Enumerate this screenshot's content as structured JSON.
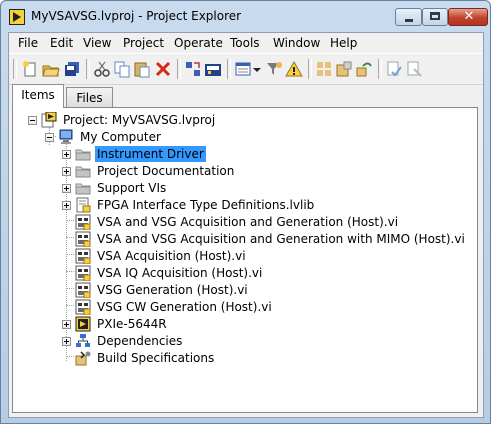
{
  "window": {
    "title": "MyVSAVSG.lvproj - Project Explorer"
  },
  "menu": [
    "File",
    "Edit",
    "View",
    "Project",
    "Operate",
    "Tools",
    "Window",
    "Help"
  ],
  "toolbar": {
    "icons": [
      "new-icon",
      "open-icon",
      "save-all-icon",
      "cut-icon",
      "copy-icon",
      "paste-icon",
      "delete-icon",
      "build-icon",
      "deploy-icon",
      "view-icon",
      "dropdown-arrow-icon",
      "filter-icon",
      "warning-icon",
      "group-icon",
      "tool1-icon",
      "tool2-icon",
      "tool3-icon",
      "tool4-icon"
    ]
  },
  "tabs": {
    "items": "Items",
    "files": "Files"
  },
  "tree": {
    "project": "Project: MyVSAVSG.lvproj",
    "computer": "My Computer",
    "children": [
      {
        "label": "Instrument Driver",
        "icon": "folder-icon",
        "expandable": true,
        "selected": true
      },
      {
        "label": "Project Documentation",
        "icon": "folder-icon",
        "expandable": true,
        "selected": false
      },
      {
        "label": "Support VIs",
        "icon": "folder-icon",
        "expandable": true,
        "selected": false
      },
      {
        "label": "FPGA Interface Type Definitions.lvlib",
        "icon": "library-icon",
        "expandable": true,
        "selected": false
      },
      {
        "label": "VSA and VSG Acquisition and Generation (Host).vi",
        "icon": "vi-icon",
        "expandable": false,
        "selected": false
      },
      {
        "label": "VSA and VSG Acquisition and Generation with MIMO (Host).vi",
        "icon": "vi-icon",
        "expandable": false,
        "selected": false
      },
      {
        "label": "VSA Acquisition (Host).vi",
        "icon": "vi-icon",
        "expandable": false,
        "selected": false
      },
      {
        "label": "VSA IQ Acquisition (Host).vi",
        "icon": "vi-icon",
        "expandable": false,
        "selected": false
      },
      {
        "label": "VSG Generation (Host).vi",
        "icon": "vi-icon",
        "expandable": false,
        "selected": false
      },
      {
        "label": "VSG CW Generation (Host).vi",
        "icon": "vi-icon",
        "expandable": false,
        "selected": false
      },
      {
        "label": "PXIe-5644R",
        "icon": "target-icon",
        "expandable": true,
        "selected": false
      },
      {
        "label": "Dependencies",
        "icon": "dependencies-icon",
        "expandable": true,
        "selected": false
      },
      {
        "label": "Build Specifications",
        "icon": "build-spec-icon",
        "expandable": false,
        "selected": false
      }
    ]
  },
  "colors": {
    "selection": "#3399ff",
    "close_button": "#c2412a",
    "titlebar": "#c9dbee"
  }
}
